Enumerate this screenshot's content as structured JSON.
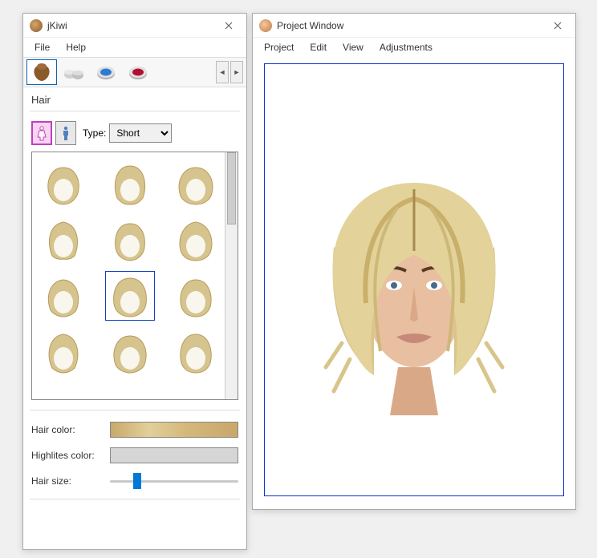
{
  "left": {
    "title": "jKiwi",
    "menu": {
      "file": "File",
      "help": "Help"
    },
    "tabs": [
      "hair",
      "accessory",
      "eyeshadow",
      "lipstick"
    ],
    "section": "Hair",
    "type_label": "Type:",
    "type_value": "Short",
    "hair_color_label": "Hair color:",
    "highlights_label": "Highlites color:",
    "hair_size_label": "Hair size:",
    "hair_size_value": 18
  },
  "right": {
    "title": "Project Window",
    "menu": {
      "project": "Project",
      "edit": "Edit",
      "view": "View",
      "adjustments": "Adjustments"
    }
  },
  "thumbnails": {
    "count": 12,
    "selected_index": 7
  },
  "colors": {
    "hair_swatch": "#d4b87a",
    "highlight_swatch": "#d6d6d6",
    "accent": "#0078d7"
  }
}
